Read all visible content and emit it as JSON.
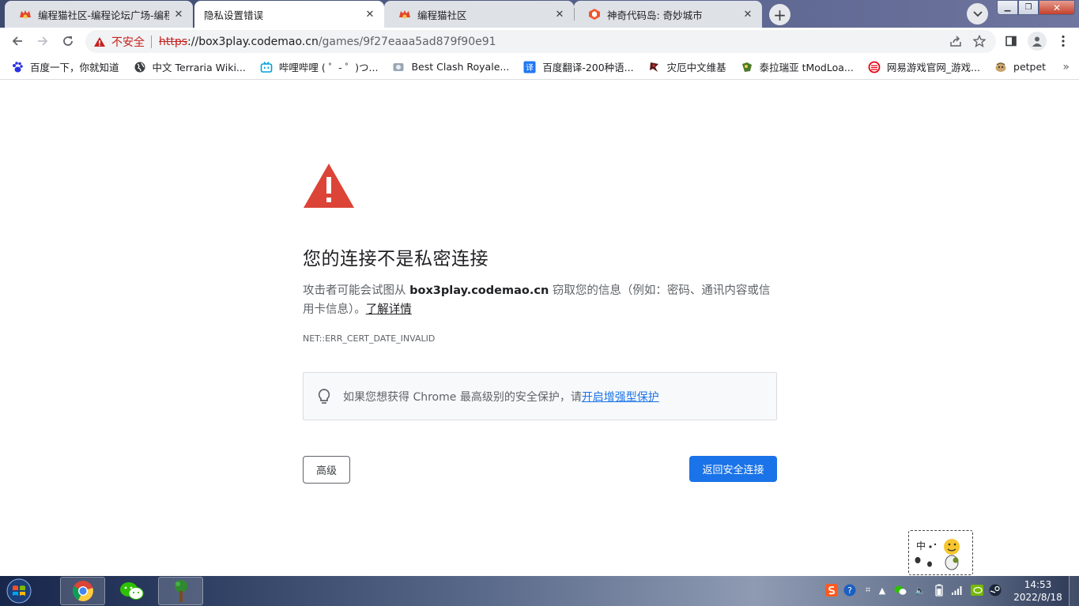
{
  "tabs": [
    {
      "title": "编程猫社区-编程论坛广场-编程学",
      "state": "inactive",
      "icon": "codemao-icon"
    },
    {
      "title": "隐私设置错误",
      "state": "active",
      "icon": "none"
    },
    {
      "title": "编程猫社区",
      "state": "inactive",
      "icon": "codemao-icon"
    },
    {
      "title": "神奇代码岛: 奇妙城市",
      "state": "inactive",
      "icon": "box3-icon"
    }
  ],
  "omnibox": {
    "security_label": "不安全",
    "url_scheme": "https",
    "url_host": "://box3play.codemao.cn",
    "url_path": "/games/9f27eaaa5ad879f90e91"
  },
  "bookmarks": [
    {
      "label": "百度一下，你就知道"
    },
    {
      "label": "中文 Terraria Wiki..."
    },
    {
      "label": "哔哩哔哩 ( ゜- ゜)つ..."
    },
    {
      "label": "Best Clash Royale..."
    },
    {
      "label": "百度翻译-200种语..."
    },
    {
      "label": "灾厄中文维基"
    },
    {
      "label": "泰拉瑞亚 tModLoa..."
    },
    {
      "label": "网易游戏官网_游戏..."
    },
    {
      "label": "petpet"
    }
  ],
  "page": {
    "heading": "您的连接不是私密连接",
    "explain_pre": "攻击者可能会试图从 ",
    "explain_host": "box3play.codemao.cn",
    "explain_post": " 窃取您的信息（例如：密码、通讯内容或信用卡信息）。",
    "learn_more": "了解详情",
    "error_code": "NET::ERR_CERT_DATE_INVALID",
    "promo_text": "如果您想获得 Chrome 最高级别的安全保护，请",
    "promo_link": "开启增强型保护",
    "advanced_button": "高级",
    "back_button": "返回安全连接"
  },
  "ime": {
    "label": "中"
  },
  "taskbar": {
    "time": "14:53",
    "date": "2022/8/18",
    "apps": [
      "chrome-icon",
      "wechat-icon",
      "terraria-icon"
    ]
  },
  "colors": {
    "accent_blue": "#1a73e8",
    "warning_red": "#db4437"
  }
}
